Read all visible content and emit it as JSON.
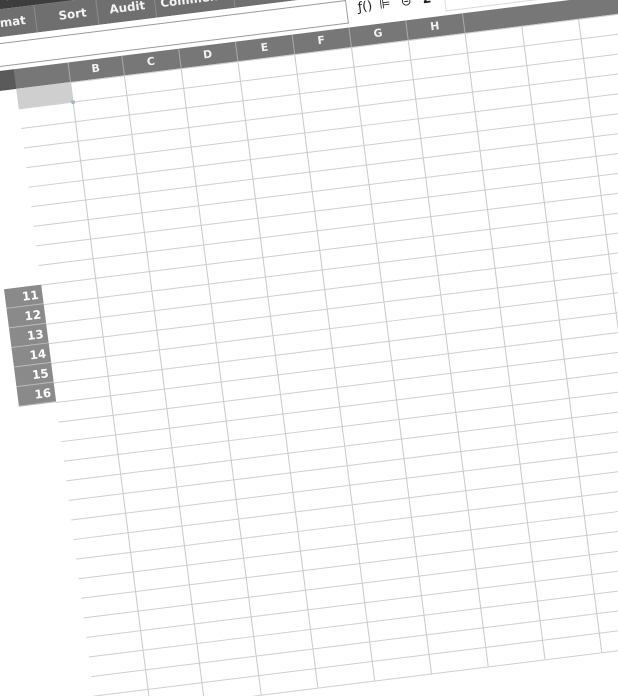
{
  "toolbar": {
    "icons": [
      "cut-icon",
      "paste-icon",
      "delete-icon",
      "paste-special-icon"
    ]
  },
  "tabs": [
    "mat",
    "Sort",
    "Audit",
    "Comment"
  ],
  "formula_icons": {
    "function": "ƒ()",
    "filter": "⊫",
    "link": "⊝",
    "sum": "Σ"
  },
  "columns": [
    "B",
    "C",
    "D",
    "E",
    "F",
    "G",
    "H"
  ],
  "rows": [
    "11",
    "12",
    "13",
    "14",
    "15",
    "16"
  ]
}
